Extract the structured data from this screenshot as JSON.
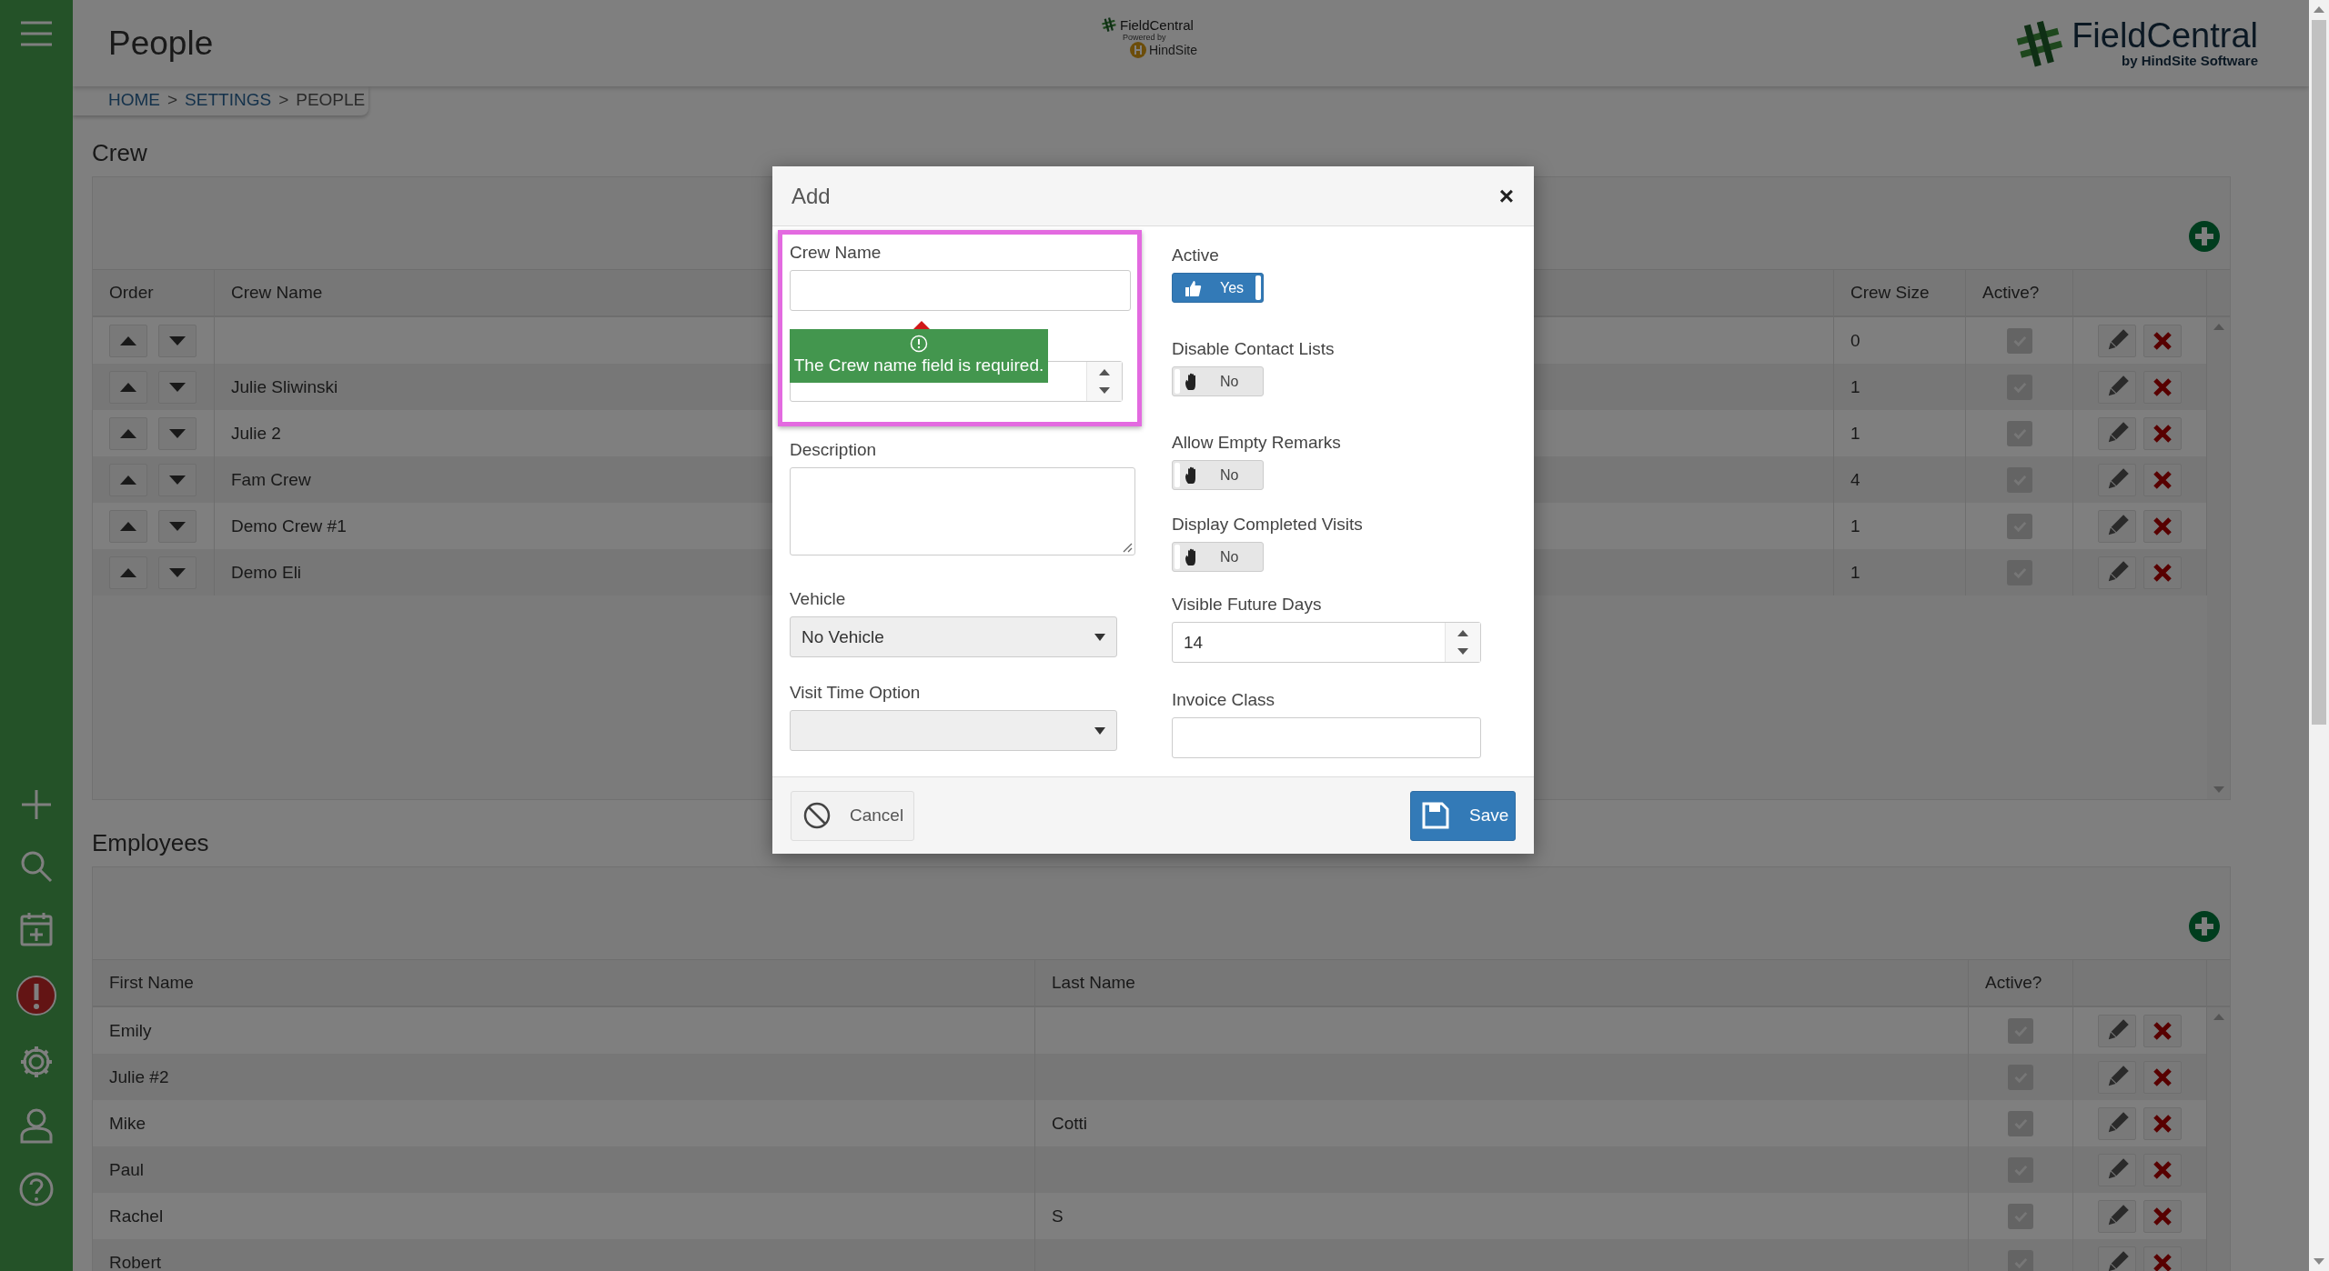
{
  "header": {
    "title": "People",
    "breadcrumb": {
      "separator": ">",
      "items": [
        {
          "label": "HOME",
          "current": false
        },
        {
          "label": "SETTINGS",
          "current": false
        },
        {
          "label": "PEOPLE",
          "current": true
        }
      ]
    },
    "small_logo": {
      "name": "FieldCentral",
      "tagline": "Powered by",
      "partner": "HindSite"
    },
    "large_logo": {
      "name": "FieldCentral",
      "tagline": "by HindSite Software"
    }
  },
  "crew": {
    "heading": "Crew",
    "columns": [
      "Order",
      "Crew Name",
      "Crew Size",
      "Active?"
    ],
    "rows": [
      {
        "crew_size": "0",
        "active": true
      },
      {
        "crew_name": "Julie Sliwinski",
        "crew_size": "1",
        "active": true
      },
      {
        "crew_name": "Julie 2",
        "crew_size": "1",
        "active": true
      },
      {
        "crew_name": "Fam Crew",
        "crew_size": "4",
        "active": true
      },
      {
        "crew_name": "Demo Crew #1",
        "crew_size": "1",
        "active": true
      },
      {
        "crew_name": "Demo Eli",
        "crew_size": "1",
        "active": true
      }
    ]
  },
  "employees": {
    "heading": "Employees",
    "columns": [
      "First Name",
      "Last Name",
      "Active?"
    ],
    "rows": [
      {
        "first_name": "Emily",
        "active": true
      },
      {
        "first_name": "Julie #2",
        "active": true
      },
      {
        "first_name": "Mike",
        "last_name": "Cotti",
        "active": true
      },
      {
        "first_name": "Paul",
        "active": true
      },
      {
        "first_name": "Rachel",
        "last_name": "S",
        "active": true
      },
      {
        "first_name": "Robert",
        "active": true
      }
    ]
  },
  "dialog": {
    "title": "Add",
    "close": "×",
    "left": [
      {
        "kind": "text",
        "label": "Crew Name",
        "highlighted": true,
        "error": "The Crew name field is required."
      },
      {
        "kind": "number",
        "highlighted": true
      },
      {
        "kind": "textarea",
        "label": "Description",
        "highlighted": false
      },
      {
        "kind": "select",
        "label": "Vehicle",
        "value": "No Vehicle",
        "highlighted": false
      },
      {
        "kind": "select",
        "label": "Visit Time Option",
        "highlighted": false
      }
    ],
    "right": [
      {
        "kind": "toggle",
        "label": "Active",
        "on": true,
        "text": "Yes"
      },
      {
        "kind": "toggle",
        "label": "Disable Contact Lists",
        "on": false,
        "text": "No"
      },
      {
        "kind": "toggle",
        "label": "Allow Empty Remarks",
        "on": false,
        "text": "No"
      },
      {
        "kind": "toggle",
        "label": "Display Completed Visits",
        "on": false,
        "text": "No"
      },
      {
        "kind": "number",
        "label": "Visible Future Days",
        "value": "14"
      },
      {
        "kind": "text",
        "label": "Invoice Class"
      }
    ],
    "buttons": [
      {
        "kind": "cancel",
        "label": "Cancel"
      },
      {
        "kind": "save",
        "label": "Save"
      }
    ]
  }
}
